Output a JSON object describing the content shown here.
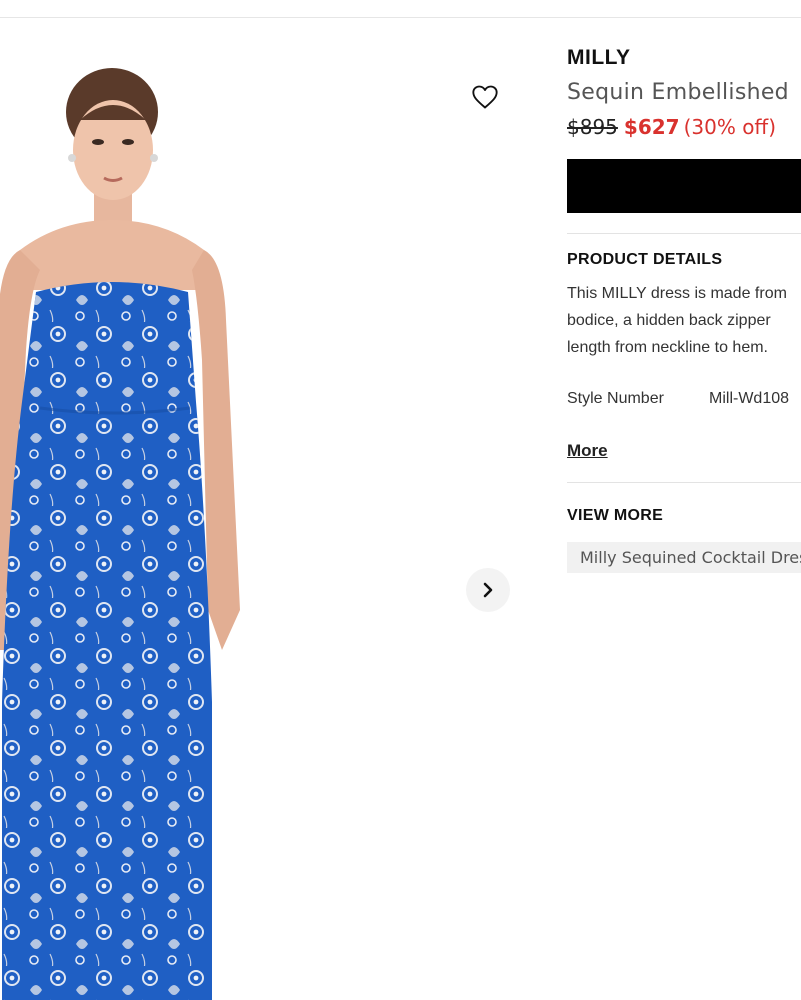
{
  "product": {
    "brand": "MILLY",
    "name": "Sequin Embellished",
    "price_original": "$895",
    "price_sale": "$627",
    "discount": "(30% off)"
  },
  "details": {
    "title": "PRODUCT DETAILS",
    "description_lines": [
      "This MILLY dress is made from",
      "bodice, a hidden back zipper",
      "length from neckline to hem."
    ],
    "spec_label": "Style Number",
    "spec_value": "Mill-Wd108",
    "more_label": "More"
  },
  "view_more": {
    "title": "VIEW MORE",
    "chip_label": "Milly Sequined Cocktail Dres"
  },
  "icons": {
    "wishlist": "heart-outline-icon",
    "next": "chevron-right-icon"
  },
  "colors": {
    "sale": "#d9322e",
    "dress_blue": "#1f5fc4",
    "button": "#000000"
  }
}
